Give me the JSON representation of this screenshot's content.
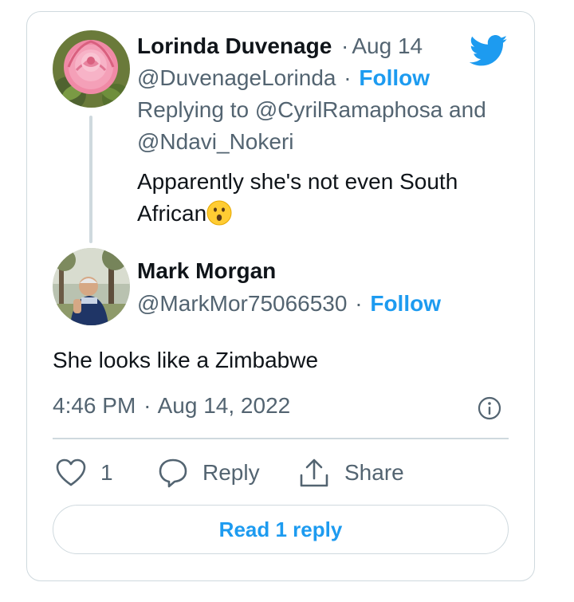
{
  "reply_tweet": {
    "author_name": "Lorinda Duvenage",
    "separator": "·",
    "date": "Aug 14",
    "handle": "@DuvenageLorinda",
    "follow_label": "Follow",
    "replying_prefix": "Replying to ",
    "replying_to_1": "@CyrilRamaphosa",
    "replying_and": " and",
    "replying_to_2": "@Ndavi_Nokeri",
    "text_line1": "Apparently she's not even South",
    "text_line2": "African",
    "emoji_icon": "hushed-face-emoji",
    "avatar_icon": "pink-rose-avatar"
  },
  "main_tweet": {
    "author_name": "Mark Morgan",
    "handle": "@MarkMor75066530",
    "follow_label": "Follow",
    "text": "She looks like a Zimbabwe",
    "time": "4:46 PM",
    "date": "Aug 14, 2022",
    "avatar_icon": "person-photo-avatar"
  },
  "actions": {
    "like_count": "1",
    "reply_label": "Reply",
    "share_label": "Share"
  },
  "read_replies_label": "Read 1 reply",
  "colors": {
    "accent": "#1d9bf0",
    "text": "#0f1419",
    "secondary": "#536471",
    "border": "#cfd9de"
  }
}
